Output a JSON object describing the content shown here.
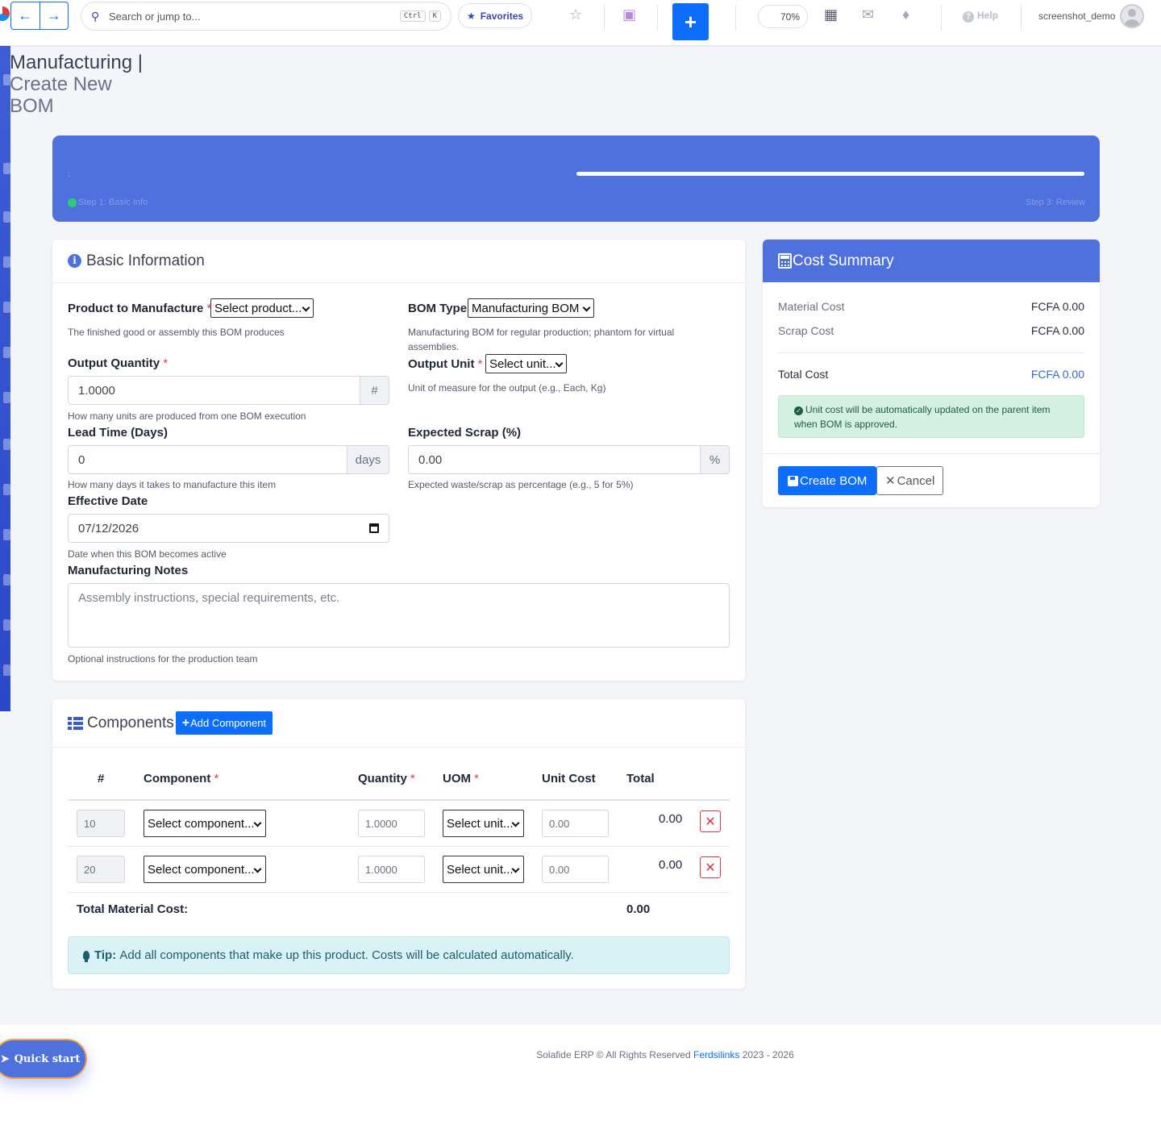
{
  "topbar": {
    "search_placeholder": "Search or jump to...",
    "kbd_ctrl": "Ctrl",
    "kbd_k": "K",
    "favorites": "Favorites",
    "zoom": "70%",
    "help": "Help",
    "username": "screenshot_demo",
    "plus": "+"
  },
  "page": {
    "title": "Manufacturing |",
    "subtitle": "Create New BOM"
  },
  "stepper": {
    "step1": "Step 1: Basic Info",
    "step3": "Step 3: Review",
    "marker": ":"
  },
  "basic": {
    "title": "Basic Information",
    "product_label": "Product to Manufacture",
    "product_value": "Select product...",
    "product_help": "The finished good or assembly this BOM produces",
    "bomtype_label": "BOM Type",
    "bomtype_value": "Manufacturing BOM",
    "bomtype_help": "Manufacturing BOM for regular production; phantom for virtual assemblies.",
    "output_qty_label": "Output Quantity",
    "output_qty_value": "1.0000",
    "output_qty_addon": "#",
    "output_qty_help": "How many units are produced from one BOM execution",
    "output_unit_label": "Output Unit",
    "output_unit_value": "Select unit...",
    "output_unit_help": "Unit of measure for the output (e.g., Each, Kg)",
    "lead_label": "Lead Time (Days)",
    "lead_value": "0",
    "lead_addon": "days",
    "lead_help": "How many days it takes to manufacture this item",
    "scrap_label": "Expected Scrap (%)",
    "scrap_value": "0.00",
    "scrap_addon": "%",
    "scrap_help": "Expected waste/scrap as percentage (e.g., 5 for 5%)",
    "eff_label": "Effective Date",
    "eff_value": "07/12/2026",
    "eff_help": "Date when this BOM becomes active",
    "notes_label": "Manufacturing Notes",
    "notes_placeholder": "Assembly instructions, special requirements, etc.",
    "notes_help": "Optional instructions for the production team",
    "req": "*"
  },
  "cost": {
    "title": "Cost Summary",
    "material_label": "Material Cost",
    "material_value": "FCFA 0.00",
    "scrap_label": "Scrap Cost",
    "scrap_value": "FCFA 0.00",
    "total_label": "Total Cost",
    "total_value": "FCFA 0.00",
    "notice": "Unit cost will be automatically updated on the parent item when BOM is approved.",
    "create_btn": "Create BOM",
    "cancel_btn": "Cancel",
    "total_color": "#3b63d6"
  },
  "components": {
    "title": "Components",
    "add_btn": "Add Component",
    "headers": {
      "num": "#",
      "component": "Component",
      "quantity": "Quantity",
      "uom": "UOM",
      "unit_cost": "Unit Cost",
      "total": "Total"
    },
    "rows": [
      {
        "seq": "10",
        "component": "Select component...",
        "qty": "1.0000",
        "uom": "Select unit...",
        "unit_cost": "0.00",
        "total": "0.00"
      },
      {
        "seq": "20",
        "component": "Select component...",
        "qty": "1.0000",
        "uom": "Select unit...",
        "unit_cost": "0.00",
        "total": "0.00"
      }
    ],
    "total_label": "Total Material Cost:",
    "total_value": "0.00",
    "tip_label": "Tip:",
    "tip_text": "Add all components that make up this product. Costs will be calculated automatically."
  },
  "footer": {
    "prefix": "Solafide ERP © All Rights Reserved",
    "link": "Ferdsilinks",
    "years": "2023 - 2026"
  },
  "quickstart": "Quick start",
  "colors": {
    "primary": "#0d6efd",
    "banner": "#4f71dd",
    "danger": "#dc3545"
  }
}
